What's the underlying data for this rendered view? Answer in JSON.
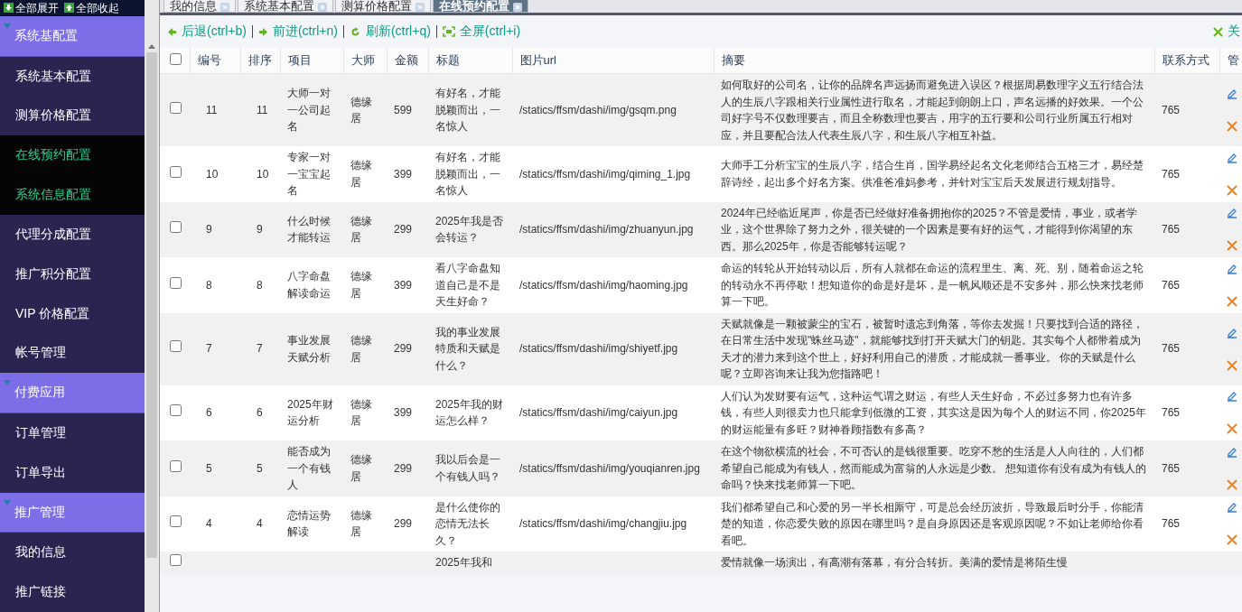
{
  "sidebar": {
    "top_buttons": [
      {
        "label": "全部展开",
        "kind": "expand"
      },
      {
        "label": "全部收起",
        "kind": "collapse"
      }
    ],
    "groups": [
      {
        "label": "系统基配置",
        "expanded": true,
        "items": [
          {
            "label": "系统基本配置",
            "selected": false
          },
          {
            "label": "测算价格配置",
            "selected": false
          },
          {
            "label": "在线预约配置",
            "selected": true
          },
          {
            "label": "系统信息配置",
            "selected": true
          },
          {
            "label": "代理分成配置",
            "selected": false
          },
          {
            "label": "推广积分配置",
            "selected": false
          },
          {
            "label": "VIP 价格配置",
            "selected": false
          },
          {
            "label": "帐号管理",
            "selected": false
          }
        ]
      },
      {
        "label": "付费应用",
        "expanded": true,
        "items": [
          {
            "label": "订单管理",
            "selected": false
          },
          {
            "label": "订单导出",
            "selected": false
          }
        ]
      },
      {
        "label": "推广管理",
        "expanded": true,
        "items": [
          {
            "label": "我的信息",
            "selected": false
          },
          {
            "label": "推广链接",
            "selected": false
          }
        ]
      }
    ]
  },
  "tabs": [
    {
      "label": "我的信息",
      "selected": false
    },
    {
      "label": "系统基本配置",
      "selected": false
    },
    {
      "label": "测算价格配置",
      "selected": false
    },
    {
      "label": "在线预约配置",
      "selected": true
    }
  ],
  "toolbar": [
    {
      "label": "后退(ctrl+b)",
      "kind": "back"
    },
    {
      "label": "前进(ctrl+n)",
      "kind": "forward"
    },
    {
      "label": "刷新(ctrl+q)",
      "kind": "refresh"
    },
    {
      "label": "全屏(ctrl+i)",
      "kind": "fullscreen"
    }
  ],
  "close_label": "关",
  "table": {
    "all_checked": false,
    "columns": [
      "编号",
      "排序",
      "项目",
      "大师",
      "金额",
      "标题",
      "图片url",
      "摘要",
      "联系方式",
      "管"
    ],
    "rows": [
      {
        "checked": false,
        "id": "11",
        "sort": "11",
        "item": "大师一对一公司起名",
        "master": "德缘居",
        "price": "599",
        "title": "有好名，才能脱颖而出，一名惊人",
        "image_url": "/statics/ffsm/dashi/img/gsqm.png",
        "summary": "如何取好的公司名，让你的品牌名声远扬而避免进入误区？根据周易数理字义五行结合法人的生辰八字跟相关行业属性进行取名，才能起到朗朗上口，声名远播的好效果。一个公司好字号不仅数理要吉，而且全称数理也要吉，用字的五行要和公司行业所属五行相对应，并且要配合法人代表生辰八字，和生辰八字相互补益。",
        "contact": "765"
      },
      {
        "checked": false,
        "id": "10",
        "sort": "10",
        "item": "专家一对一宝宝起名",
        "master": "德缘居",
        "price": "399",
        "title": "有好名，才能脱颖而出，一名惊人",
        "image_url": "/statics/ffsm/dashi/img/qiming_1.jpg",
        "summary": "大师手工分析宝宝的生辰八字，结合生肖，国学易经起名文化老师结合五格三才，易经楚辞诗经，起出多个好名方案。供准爸准妈参考，并针对宝宝后天发展进行规划指导。",
        "contact": "765"
      },
      {
        "checked": false,
        "id": "9",
        "sort": "9",
        "item": "什么时候才能转运",
        "master": "德缘居",
        "price": "299",
        "title": "2025年我是否会转运？",
        "image_url": "/statics/ffsm/dashi/img/zhuanyun.jpg",
        "summary": "2024年已经临近尾声，你是否已经做好准备拥抱你的2025？不管是爱情，事业，或者学业，这个世界除了努力之外，很关键的一个因素是要有好的运气，才能得到你渴望的东西。那么2025年，你是否能够转运呢？",
        "contact": "765"
      },
      {
        "checked": false,
        "id": "8",
        "sort": "8",
        "item": "八字命盘解读命运",
        "master": "德缘居",
        "price": "399",
        "title": "看八字命盘知道自己是不是天生好命？",
        "image_url": "/statics/ffsm/dashi/img/haoming.jpg",
        "summary": "命运的转轮从开始转动以后，所有人就都在命运的流程里生、离、死、别，随着命运之轮的转动永不再停歇！想知道你的命是好是坏，是一帆风顺还是不安多舛，那么快来找老师算一下吧。",
        "contact": "765"
      },
      {
        "checked": false,
        "id": "7",
        "sort": "7",
        "item": "事业发展天赋分析",
        "master": "德缘居",
        "price": "299",
        "title": "我的事业发展特质和天赋是什么？",
        "image_url": "/statics/ffsm/dashi/img/shiyetf.jpg",
        "summary": "天赋就像是一颗被蒙尘的宝石，被暂时遗忘到角落，等你去发掘！只要找到合适的路径，在日常生活中发现\"蛛丝马迹\"，就能够找到打开天赋大门的钥匙。其实每个人都带着成为天才的潜力来到这个世上，好好利用自己的潜质，才能成就一番事业。 你的天赋是什么呢？立即咨询来让我为您指路吧！",
        "contact": "765"
      },
      {
        "checked": false,
        "id": "6",
        "sort": "6",
        "item": "2025年财运分析",
        "master": "德缘居",
        "price": "399",
        "title": "2025年我的财运怎么样？",
        "image_url": "/statics/ffsm/dashi/img/caiyun.jpg",
        "summary": "人们认为发财要有运气，这种运气谓之财运，有些人天生好命，不必过多努力也有许多钱，有些人则很卖力也只能拿到低微的工资，其实这是因为每个人的财运不同，你2025年的财运能量有多旺？财神眷顾指数有多高？",
        "contact": "765"
      },
      {
        "checked": false,
        "id": "5",
        "sort": "5",
        "item": "能否成为一个有钱人",
        "master": "德缘居",
        "price": "299",
        "title": "我以后会是一个有钱人吗？",
        "image_url": "/statics/ffsm/dashi/img/youqianren.jpg",
        "summary": "在这个物欲横流的社会，不可否认的是钱很重要。吃穿不愁的生活是人人向往的，人们都希望自己能成为有钱人，然而能成为富翁的人永远是少数。 想知道你有没有成为有钱人的命吗？快来找老师算一下吧。",
        "contact": "765"
      },
      {
        "checked": false,
        "id": "4",
        "sort": "4",
        "item": "恋情运势解读",
        "master": "德缘居",
        "price": "299",
        "title": "是什么使你的恋情无法长久？",
        "image_url": "/statics/ffsm/dashi/img/changjiu.jpg",
        "summary": "我们都希望自己和心爱的另一半长相厮守，可是总会经历波折，导致最后时分手，你能清楚的知道，你恋爱失败的原因在哪里吗？是自身原因还是客观原因呢？不如让老师给你看看吧。",
        "contact": "765"
      },
      {
        "checked": false,
        "title": "2025年我和",
        "summary": "爱情就像一场演出，有高潮有落幕，有分合转折。美满的爱情是将陌生慢"
      }
    ]
  }
}
